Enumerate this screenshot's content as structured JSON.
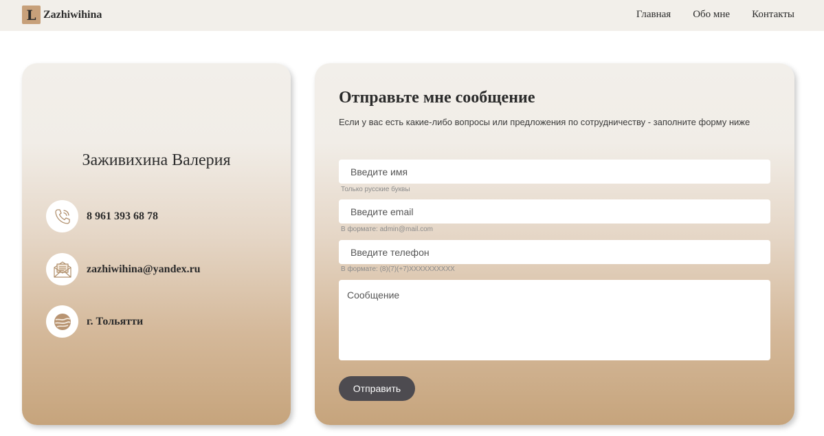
{
  "header": {
    "logo_letter": "L",
    "logo_text": "Zazhiwihina",
    "nav": [
      "Главная",
      "Обо мне",
      "Контакты"
    ]
  },
  "profile": {
    "name": "Заживихина Валерия",
    "contacts": [
      {
        "icon": "phone-icon",
        "text": "8 961 393 68 78"
      },
      {
        "icon": "mail-icon",
        "text": "zazhiwihina@yandex.ru"
      },
      {
        "icon": "globe-icon",
        "text": "г. Тольятти"
      }
    ]
  },
  "form": {
    "title": "Отправьте мне сообщение",
    "description": "Если у вас есть какие-либо вопросы или предложения по сотрудничеству - заполните форму ниже",
    "name_placeholder": "Введите имя",
    "name_hint": "Только русские буквы",
    "email_placeholder": "Введите email",
    "email_hint": "В формате: admin@mail.com",
    "phone_placeholder": "Введите телефон",
    "phone_hint": "В формате: (8)(7)(+7)XXXXXXXXXX",
    "message_placeholder": "Сообщение",
    "submit_label": "Отправить"
  },
  "colors": {
    "accent": "#c6a47c",
    "button": "#4d4b50",
    "header_bg": "#f2efea"
  }
}
